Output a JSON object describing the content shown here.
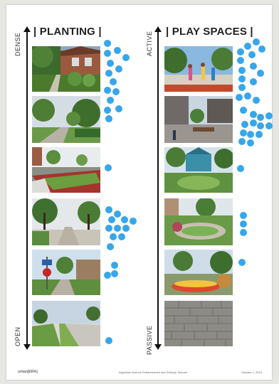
{
  "left": {
    "title": "| PLANTING |",
    "axis_top": "DENSE",
    "axis_bottom": "OPEN"
  },
  "right": {
    "title": "| PLAY SPACES |",
    "axis_top": "ACTIVE",
    "axis_bottom": "PASSIVE"
  },
  "footer": {
    "left": "urban[ERA]",
    "center": "Algonkian Avenue Enhancement and Delicary Taxonst",
    "right": "October 1, 2014"
  },
  "colors": {
    "dot": "#37a6ea",
    "axis": "#111111"
  }
}
